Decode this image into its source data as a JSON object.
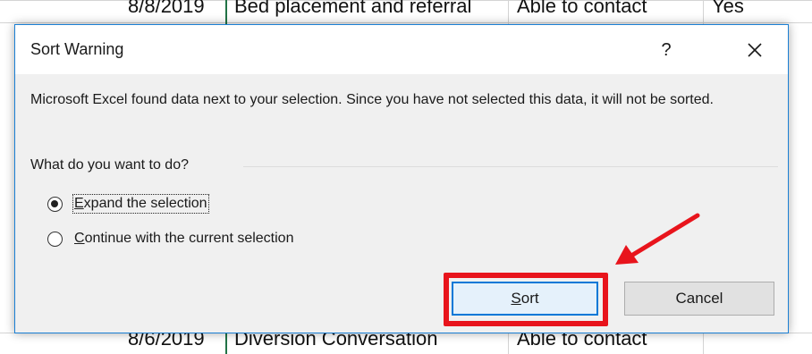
{
  "sheet": {
    "top_row": [
      "8/8/2019",
      "Bed placement and referral",
      "Able to contact",
      "Yes"
    ],
    "bottom_row": [
      "8/6/2019",
      "Diversion Conversation",
      "Able to contact",
      ""
    ]
  },
  "dialog": {
    "title": "Sort Warning",
    "help_glyph": "?",
    "message": "Microsoft Excel found data next to your selection.  Since you have not selected this data, it will not be sorted.",
    "question": "What do you want to do?",
    "options": [
      {
        "accel": "E",
        "rest": "xpand the selection",
        "checked": true
      },
      {
        "accel": "C",
        "rest": "ontinue with the current selection",
        "checked": false
      }
    ],
    "buttons": {
      "sort_accel": "S",
      "sort_rest": "ort",
      "cancel": "Cancel"
    }
  },
  "annotation": {
    "highlight_color": "#e8141c",
    "arrow_color": "#e8141c",
    "arrow_icon": "red-pointer-arrow"
  },
  "colors": {
    "dialog_border": "#1a7fd4",
    "default_button_border": "#0078d7",
    "sheet_green_border": "#217346"
  }
}
